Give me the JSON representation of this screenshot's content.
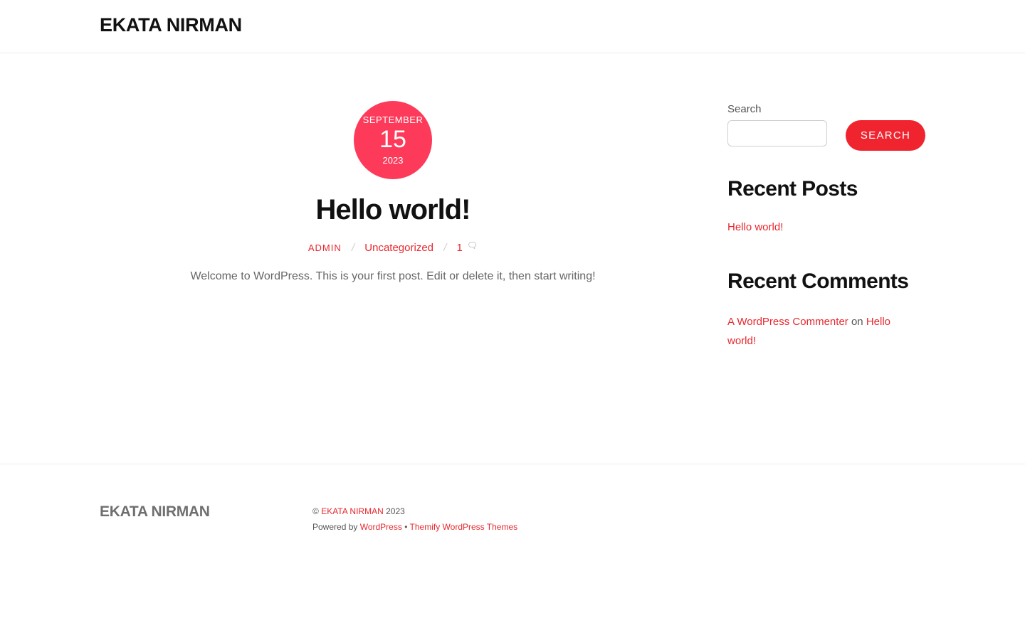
{
  "site": {
    "title": "EKATA NIRMAN"
  },
  "post": {
    "date": {
      "month": "SEPTEMBER",
      "day": "15",
      "year": "2023"
    },
    "title": "Hello world!",
    "author": "ADMIN",
    "separator": "/",
    "category": "Uncategorized",
    "comment_count": "1",
    "excerpt": "Welcome to WordPress. This is your first post. Edit or delete it, then start writing!"
  },
  "sidebar": {
    "search_label": "Search",
    "search_value": "",
    "search_button": "SEARCH",
    "recent_posts_title": "Recent Posts",
    "recent_posts": [
      "Hello world!"
    ],
    "recent_comments_title": "Recent Comments",
    "recent_comment": {
      "author": "A WordPress Commenter",
      "on": "on",
      "post": "Hello world!"
    }
  },
  "footer": {
    "title": "EKATA NIRMAN",
    "copyright_symbol": "©",
    "copyright_name": "EKATA NIRMAN",
    "copyright_year": "2023",
    "powered_by": "Powered by",
    "wordpress": "WordPress",
    "bullet": "•",
    "themify": "Themify WordPress Themes"
  },
  "colors": {
    "accent": "#e8272e",
    "date_badge": "#fe3a5a",
    "button": "#f0242f"
  },
  "icons": {
    "comment": "speech-bubble-icon"
  }
}
